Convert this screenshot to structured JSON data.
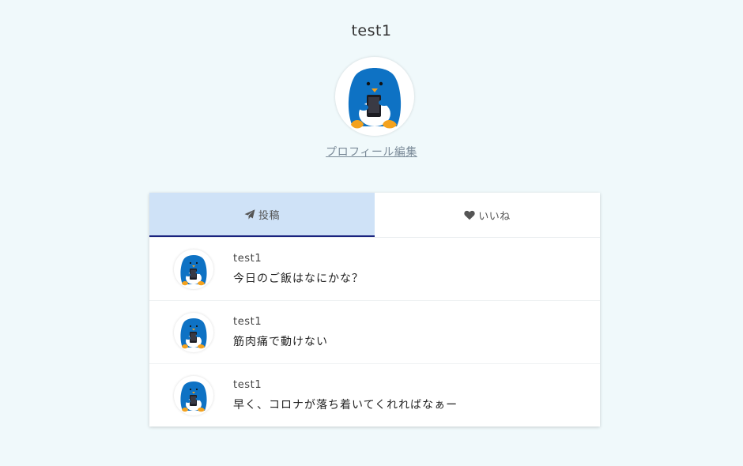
{
  "profile": {
    "username": "test1",
    "avatar_icon": "penguin-avatar-icon",
    "edit_link": "プロフィール編集"
  },
  "tabs": [
    {
      "label": "投稿",
      "icon": "paper-plane-icon",
      "active": true
    },
    {
      "label": "いいね",
      "icon": "heart-icon",
      "active": false
    }
  ],
  "posts": [
    {
      "user": "test1",
      "body": "今日のご飯はなにかな？",
      "avatar_icon": "penguin-avatar-icon"
    },
    {
      "user": "test1",
      "body": "筋肉痛で動けない",
      "avatar_icon": "penguin-avatar-icon"
    },
    {
      "user": "test1",
      "body": "早く、コロナが落ち着いてくれればなぁー",
      "avatar_icon": "penguin-avatar-icon"
    }
  ],
  "colors": {
    "page_background": "#f0f9fb",
    "active_tab_background": "#cfe2f7",
    "active_tab_underline": "#1a237e",
    "penguin_blue": "#0e72c4",
    "penguin_feet": "#f4a21e"
  }
}
